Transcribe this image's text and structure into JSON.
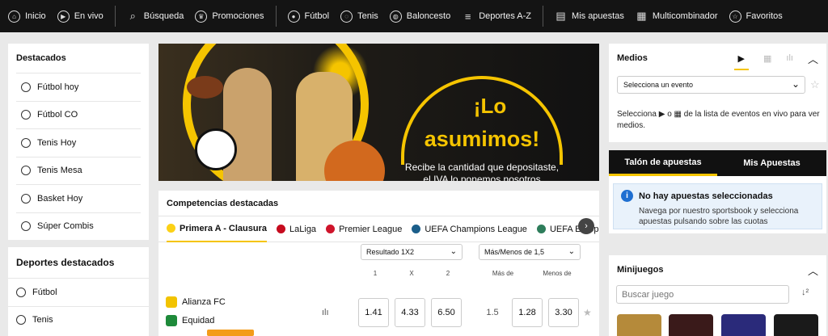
{
  "topnav": [
    {
      "label": "Inicio",
      "icon": "home-icon",
      "glyph": "⌂"
    },
    {
      "label": "En vivo",
      "icon": "live-play-icon",
      "glyph": "▶"
    },
    {
      "label": "Búsqueda",
      "icon": "search-icon",
      "glyph": "⌕"
    },
    {
      "label": "Promociones",
      "icon": "trophy-icon",
      "glyph": "♛"
    },
    {
      "label": "Fútbol",
      "icon": "soccer-ball-icon",
      "glyph": "●"
    },
    {
      "label": "Tenis",
      "icon": "tennis-ball-icon",
      "glyph": "◌"
    },
    {
      "label": "Baloncesto",
      "icon": "basketball-icon",
      "glyph": "◍"
    },
    {
      "label": "Deportes A-Z",
      "icon": "menu-icon",
      "glyph": "≡"
    },
    {
      "label": "Mis apuestas",
      "icon": "my-bets-icon",
      "glyph": "▤"
    },
    {
      "label": "Multicombinador",
      "icon": "multicombinador-icon",
      "glyph": "▦"
    },
    {
      "label": "Favoritos",
      "icon": "star-icon",
      "glyph": "☆"
    }
  ],
  "sidebar": {
    "destacados_title": "Destacados",
    "items": [
      {
        "label": "Fútbol hoy",
        "icon": "soccer-ball-icon"
      },
      {
        "label": "Fútbol CO",
        "icon": "trophy-icon"
      },
      {
        "label": "Tenis Hoy",
        "icon": "tennis-ball-icon"
      },
      {
        "label": "Tenis Mesa",
        "icon": "table-tennis-icon"
      },
      {
        "label": "Basket Hoy",
        "icon": "basketball-icon"
      },
      {
        "label": "Súper Combis",
        "icon": "plus-circle-icon"
      }
    ],
    "deportes_title": "Deportes destacados",
    "deportes": [
      {
        "label": "Fútbol",
        "icon": "soccer-ball-icon"
      },
      {
        "label": "Tenis",
        "icon": "tennis-ball-icon"
      }
    ]
  },
  "banner": {
    "headline1": "¡Lo",
    "headline2": "asumimos!",
    "line1": "Recibe la cantidad que depositaste,",
    "line2": "el IVA lo ponemos nosotros"
  },
  "competencias": {
    "title": "Competencias destacadas",
    "tabs": [
      {
        "label": "Primera A - Clausura",
        "color": "#fcd116"
      },
      {
        "label": "LaLiga",
        "color": "#c60b1e"
      },
      {
        "label": "Premier League",
        "color": "#cf142b"
      },
      {
        "label": "UEFA Champions League",
        "color": "#1b5e8a"
      },
      {
        "label": "UEFA Europa League",
        "color": "#2e7d5b"
      }
    ],
    "market1": "Resultado 1X2",
    "market2": "Más/Menos de 1,5",
    "cols": [
      "1",
      "X",
      "2",
      "Más de",
      "Menos de"
    ],
    "match": {
      "home": "Alianza FC",
      "away": "Equidad",
      "odd1": "1.41",
      "oddx": "4.33",
      "odd2": "6.50",
      "line": "1.5",
      "over": "1.28",
      "under": "3.30"
    }
  },
  "medios": {
    "title": "Medios",
    "select_placeholder": "Selecciona un evento",
    "info_a": "Selecciona",
    "info_o": "o",
    "info_b": "de la lista de eventos en vivo para ver medios."
  },
  "betslip": {
    "tab1": "Talón de apuestas",
    "tab2": "Mis Apuestas",
    "empty_title": "No hay apuestas seleccionadas",
    "empty_text": "Navega por nuestro sportsbook y selecciona apuestas pulsando sobre las cuotas"
  },
  "minijuegos": {
    "title": "Minijuegos",
    "search_placeholder": "Buscar juego"
  },
  "colors": {
    "accent": "#f5c400",
    "topbar": "#141414"
  }
}
